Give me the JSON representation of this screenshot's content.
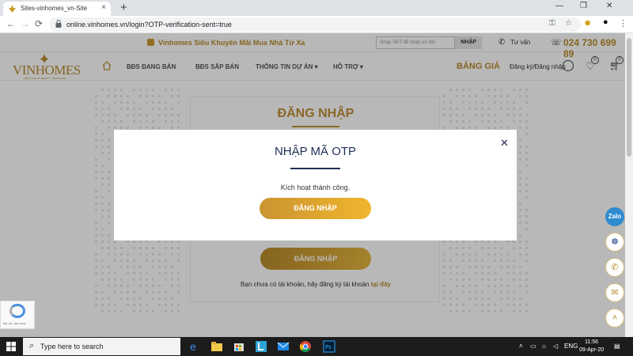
{
  "browser": {
    "tab_title": "Sites-vinhomes_vn-Site",
    "tab_close": "×",
    "new_tab": "+",
    "url": "online.vinhomes.vn/login?OTP-verification-sent=true",
    "window": {
      "minimize": "—",
      "restore": "❐",
      "close": "✕"
    },
    "icons": {
      "back": "back-arrow-icon",
      "forward": "forward-arrow-icon",
      "reload": "reload-icon",
      "lock": "lock-icon",
      "key": "key-icon",
      "star": "star-icon",
      "menu": "kebab-menu-icon"
    }
  },
  "promo": {
    "text": "Vinhomes Siêu Khuyến Mãi Mua Nhà Từ Xa",
    "search_placeholder": "Nhập SĐT để nhận ưu đãi",
    "search_button": "NHẬP",
    "consult": "Tư vấn",
    "hotline": "024 730 699 89"
  },
  "nav": {
    "logo": "VINHOMES",
    "logo_tagline": "FOR A LIFE OF BEAUTY · SINCE 2008",
    "items": [
      "BĐS ĐANG BÁN",
      "BĐS SẮP BÁN",
      "THÔNG TIN DỰ ÁN ▾",
      "HỖ TRỢ ▾"
    ],
    "price_list": "BẢNG GIÁ",
    "login": "Đăng ký/Đăng nhập",
    "wishlist_count": "0",
    "cart_count": "0"
  },
  "login_card": {
    "title": "ĐĂNG NHẬP",
    "button": "ĐĂNG NHẬP",
    "register_text": "Bạn chưa có tài khoản, hãy đăng ký tài khoản",
    "register_link": "tại đây"
  },
  "modal": {
    "title": "NHẬP MÃ OTP",
    "close": "✕",
    "message": "Kích hoạt thành công.",
    "button": "ĐĂNG NHẬP"
  },
  "widgets": {
    "zalo": "Zalo",
    "recaptcha": "Bảo mật - Điều khoản"
  },
  "taskbar": {
    "search_placeholder": "Type here to search",
    "language": "ENG",
    "time": "11:56",
    "date": "09-Apr-20"
  },
  "colors": {
    "gold": "#b98c2c",
    "navy": "#1f2e55",
    "button_gradient_start": "#ca9431",
    "button_gradient_end": "#f1b52d"
  }
}
